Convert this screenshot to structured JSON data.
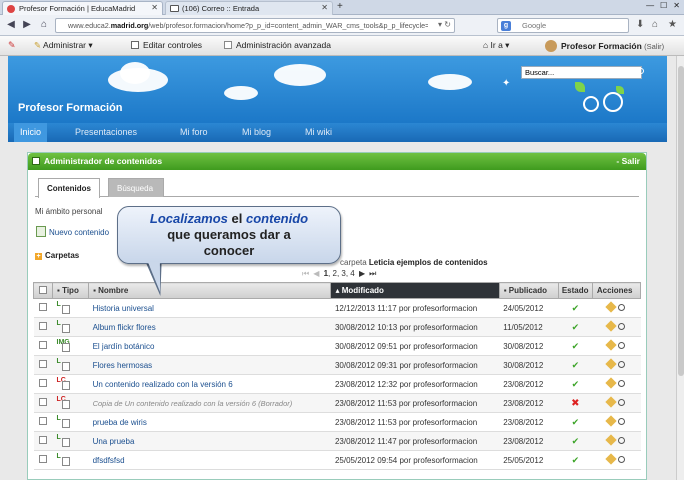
{
  "browser": {
    "tabs": [
      {
        "label": "Profesor Formación | EducaMadrid",
        "active": true
      },
      {
        "label": "(106) Correo :: Entrada",
        "active": false
      }
    ],
    "url_prefix": "www.educa2.",
    "url_domain": "madrid.org",
    "url_path": "/web/profesor.formacion/home?p_p_id=content_admin_WAR_cms_tools&p_p_lifecycle=0&p_p",
    "search_placeholder": "Google"
  },
  "dockbar": {
    "admin": "Administrar ▾",
    "edit_controls": "Editar controles",
    "advanced_admin": "Administración avanzada",
    "goto": "Ir a ▾",
    "user": "Profesor Formación",
    "logout": "(Salir)"
  },
  "site": {
    "title": "Profesor Formación",
    "search_value": "Buscar..."
  },
  "menu": [
    "Inicio",
    "Presentaciones",
    "Mi foro",
    "Mi blog",
    "Mi wiki"
  ],
  "portlet": {
    "title": "Administrador de contenidos",
    "close": "- Salir",
    "tabs": [
      "Contenidos",
      "Búsqueda"
    ],
    "scope": "Mi ámbito personal",
    "new_content": "Nuevo contenido",
    "folders": "Carpetas",
    "path_pre": "carpeta",
    "path_folder": "Leticia ejemplos de contenidos",
    "pager_current": "1",
    "pager_pages": ", 2, 3, 4"
  },
  "callout": {
    "line1_a": "Localizamos",
    "line1_b": " el ",
    "line1_c": "contenido",
    "line2": "que queramos dar a",
    "line3": "conocer"
  },
  "table": {
    "headers": {
      "type": "Tipo",
      "name": "Nombre",
      "modified": "Modificado",
      "published": "Publicado",
      "status": "Estado",
      "actions": "Acciones"
    },
    "rows": [
      {
        "type": "L",
        "name": "Historia universal",
        "modified": "12/12/2013 11:17 por profesorformacion",
        "published": "24/05/2012",
        "status": "ok"
      },
      {
        "type": "L",
        "name": "Album flickr flores",
        "modified": "30/08/2012 10:13 por profesorformacion",
        "published": "11/05/2012",
        "status": "ok"
      },
      {
        "type": "IMG",
        "name": "El jardín botánico",
        "modified": "30/08/2012 09:51 por profesorformacion",
        "published": "30/08/2012",
        "status": "ok"
      },
      {
        "type": "L",
        "name": "Flores hermosas",
        "modified": "30/08/2012 09:31 por profesorformacion",
        "published": "30/08/2012",
        "status": "ok"
      },
      {
        "type": "LC",
        "name": "Un contenido realizado con la versión 6",
        "modified": "23/08/2012 12:32 por profesorformacion",
        "published": "23/08/2012",
        "status": "ok"
      },
      {
        "type": "LC",
        "name": "Copia de Un contenido realizado con la versión 6 (Borrador)",
        "modified": "23/08/2012 11:53 por profesorformacion",
        "published": "23/08/2012",
        "status": "draft"
      },
      {
        "type": "L",
        "name": "prueba de wiris",
        "modified": "23/08/2012 11:53 por profesorformacion",
        "published": "23/08/2012",
        "status": "ok"
      },
      {
        "type": "L",
        "name": "Una prueba",
        "modified": "23/08/2012 11:47 por profesorformacion",
        "published": "23/08/2012",
        "status": "ok"
      },
      {
        "type": "L",
        "name": "dfsdfsfsd",
        "modified": "25/05/2012 09:54 por profesorformacion",
        "published": "25/05/2012",
        "status": "ok"
      }
    ]
  },
  "colors": {
    "accent_green": "#4aa527",
    "banner_blue": "#1c78c8",
    "link": "#1b4f8f"
  }
}
